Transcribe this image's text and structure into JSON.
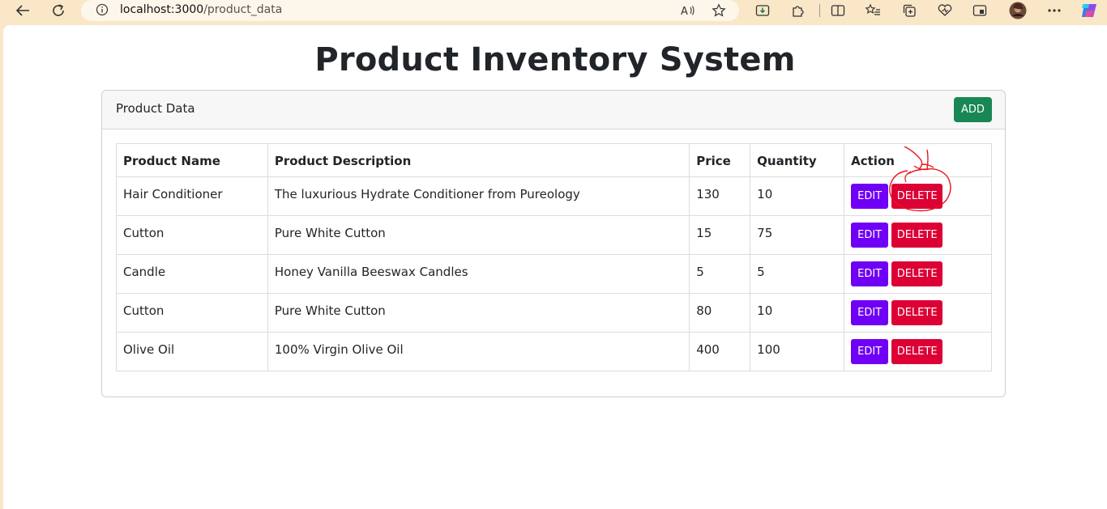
{
  "browser": {
    "url_host": "localhost:3000",
    "url_path": "/product_data"
  },
  "page": {
    "title": "Product Inventory System"
  },
  "card": {
    "header_title": "Product Data",
    "add_label": "ADD"
  },
  "table": {
    "columns": [
      "Product Name",
      "Product Description",
      "Price",
      "Quantity",
      "Action"
    ],
    "rows": [
      {
        "name": "Hair Conditioner",
        "description": "The luxurious Hydrate Conditioner from Pureology",
        "price": "130",
        "quantity": "10"
      },
      {
        "name": "Cutton",
        "description": "Pure White Cutton",
        "price": "15",
        "quantity": "75"
      },
      {
        "name": "Candle",
        "description": "Honey Vanilla Beeswax Candles",
        "price": "5",
        "quantity": "5"
      },
      {
        "name": "Cutton",
        "description": "Pure White Cutton",
        "price": "80",
        "quantity": "10"
      },
      {
        "name": "Olive Oil",
        "description": "100% Virgin Olive Oil",
        "price": "400",
        "quantity": "100"
      }
    ],
    "edit_label": "EDIT",
    "delete_label": "DELETE"
  },
  "colors": {
    "add": "#198754",
    "edit": "#6f00f5",
    "delete": "#dc0035",
    "annotation": "#e8141c"
  }
}
